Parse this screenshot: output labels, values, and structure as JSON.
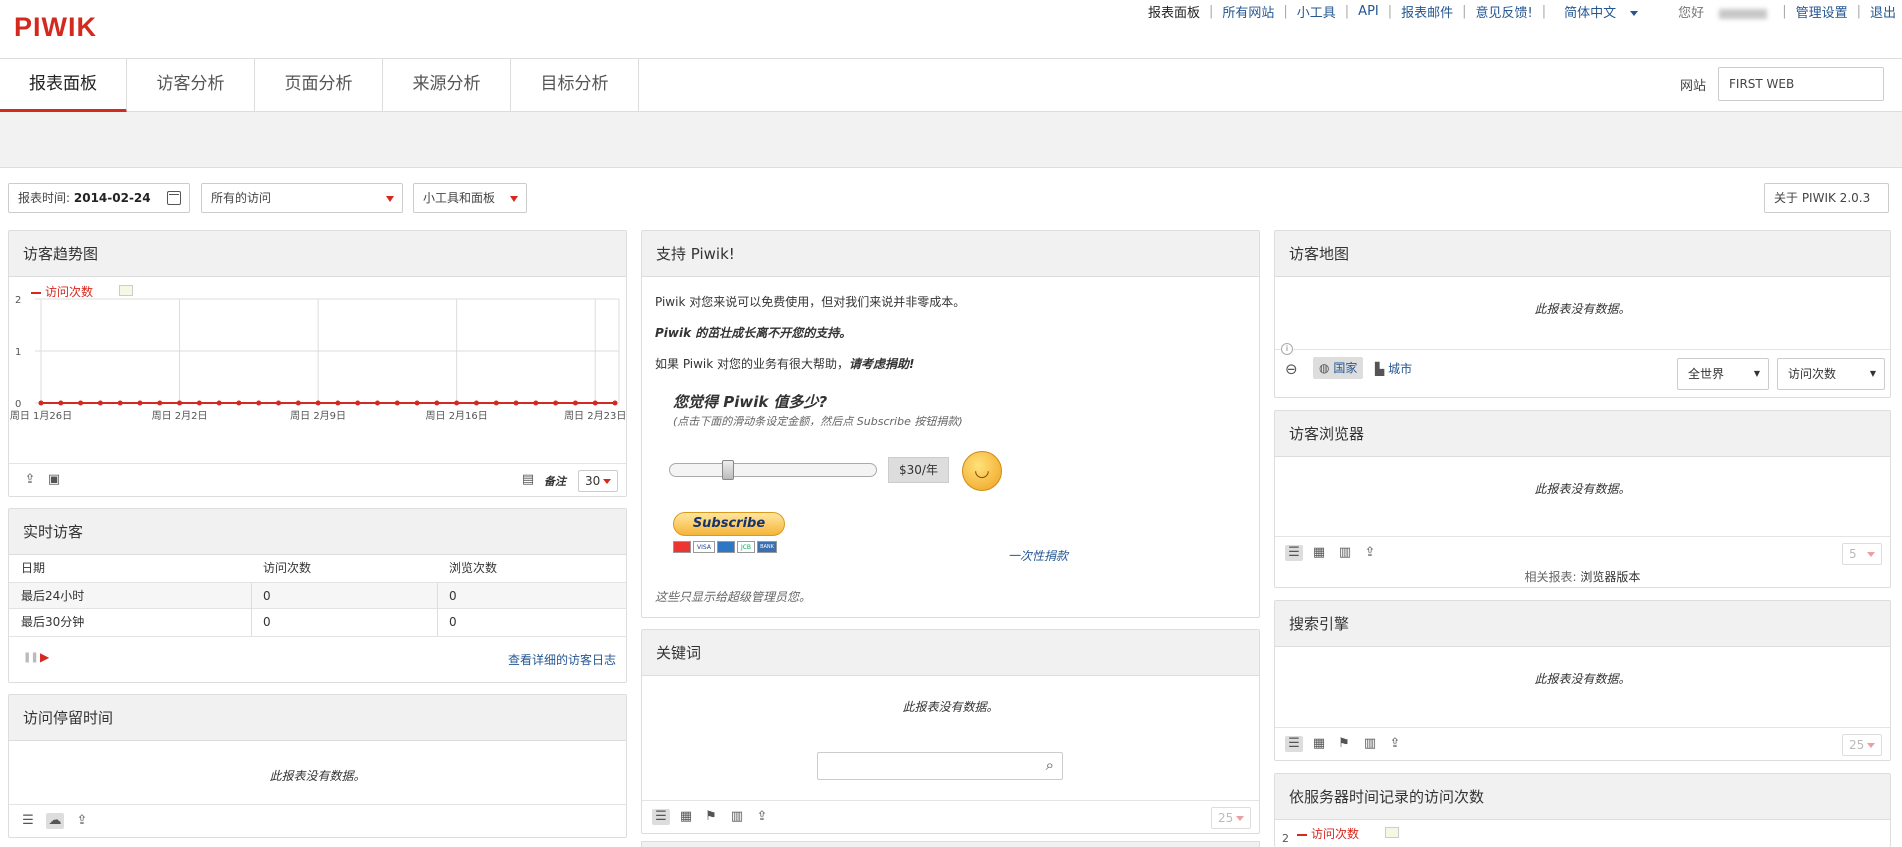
{
  "app": {
    "logo": "PIWIK"
  },
  "toplinks": [
    {
      "label": "报表面板",
      "current": true
    },
    {
      "label": "所有网站"
    },
    {
      "label": "小工具"
    },
    {
      "label": "API"
    },
    {
      "label": "报表邮件"
    },
    {
      "label": "意见反馈!"
    },
    {
      "label": "简体中文"
    }
  ],
  "user": {
    "greeting": "您好",
    "admin": "管理设置",
    "logout": "退出"
  },
  "nav": {
    "tabs": [
      "报表面板",
      "访客分析",
      "页面分析",
      "来源分析",
      "目标分析"
    ],
    "site_label": "网站",
    "site_value": "FIRST  WEB"
  },
  "controls": {
    "period_label": "报表时间:",
    "period_value": "2014-02-24",
    "segment": "所有的访问",
    "dashboard": "小工具和面板",
    "about": "关于 PIWIK 2.0.3"
  },
  "common": {
    "no_data": "此报表没有数据。"
  },
  "colors": {
    "accent": "#d4291f",
    "link": "#255792",
    "header_bg": "#f1f1f1"
  },
  "evolution": {
    "title": "访客趋势图",
    "legend": "访问次数",
    "annotations": "备注",
    "limit": "30"
  },
  "chart_data": {
    "type": "line",
    "series": [
      {
        "name": "访问次数",
        "values": [
          0,
          0,
          0,
          0,
          0,
          0,
          0,
          0,
          0,
          0,
          0,
          0,
          0,
          0,
          0,
          0,
          0,
          0,
          0,
          0,
          0,
          0,
          0,
          0,
          0,
          0,
          0,
          0,
          0,
          0
        ]
      }
    ],
    "x_tick_labels": [
      "周日 1月26日",
      "周日 2月2日",
      "周日 2月9日",
      "周日 2月16日",
      "周日 2月23日"
    ],
    "y_tick_labels": [
      "2",
      "1",
      "0"
    ],
    "ylim": [
      0,
      2
    ],
    "grid": true
  },
  "realtime": {
    "title": "实时访客",
    "headers": [
      "日期",
      "访问次数",
      "浏览次数"
    ],
    "rows": [
      [
        "最后24小时",
        "0",
        "0"
      ],
      [
        "最后30分钟",
        "0",
        "0"
      ]
    ],
    "log_link": "查看详细的访客日志"
  },
  "visit_length": {
    "title": "访问停留时间"
  },
  "support": {
    "title": "支持 Piwik!",
    "line1": "Piwik 对您来说可以免费使用，但对我们来说并非零成本。",
    "line2": "Piwik 的茁壮成长离不开您的支持。",
    "line3_a": "如果 Piwik 对您的业务有很大帮助，",
    "line3_b": "请考虑捐助!",
    "question": "您觉得 Piwik 值多少?",
    "hint": "(点击下面的滑动条设定金额，然后点 Subscribe 按钮捐款)",
    "amount": "$30/年",
    "subscribe": "Subscribe",
    "card_labels": [
      "VISA",
      "JCB",
      "BANK"
    ],
    "once_link": "一次性捐款",
    "admin_note": "这些只显示给超级管理员您。"
  },
  "keywords": {
    "title": "关键词",
    "limit": "25"
  },
  "map": {
    "title": "访客地图",
    "country": "国家",
    "city": "城市",
    "region_select": "全世界",
    "metric_select": "访问次数"
  },
  "browsers": {
    "title": "访客浏览器",
    "limit": "5",
    "related_label": "相关报表:",
    "related_link": "浏览器版本"
  },
  "search_engines": {
    "title": "搜索引擎",
    "limit": "25"
  },
  "server_time": {
    "title": "依服务器时间记录的访问次数",
    "legend": "访问次数",
    "y_top": "2"
  }
}
